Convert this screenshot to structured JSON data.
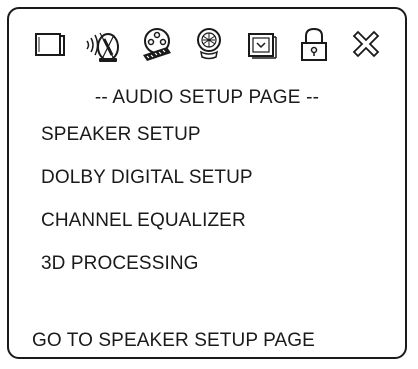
{
  "toolbar": {
    "icons": [
      {
        "name": "tv-icon"
      },
      {
        "name": "audio-speaker-icon"
      },
      {
        "name": "video-film-reel-icon"
      },
      {
        "name": "preference-icon"
      },
      {
        "name": "setup-box-icon"
      },
      {
        "name": "lock-icon"
      },
      {
        "name": "exit-icon"
      }
    ]
  },
  "page": {
    "title": "-- AUDIO SETUP PAGE --"
  },
  "menu": {
    "items": [
      {
        "label": "SPEAKER SETUP"
      },
      {
        "label": "DOLBY DIGITAL SETUP"
      },
      {
        "label": "CHANNEL EQUALIZER"
      },
      {
        "label": "3D PROCESSING"
      }
    ]
  },
  "status": {
    "text": "GO TO SPEAKER SETUP PAGE"
  }
}
